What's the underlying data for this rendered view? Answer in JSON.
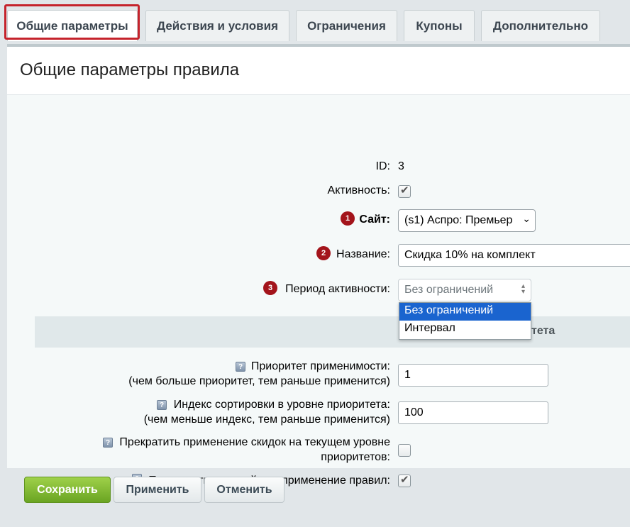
{
  "tabs": [
    "Общие параметры",
    "Действия и условия",
    "Ограничения",
    "Купоны",
    "Дополнительно"
  ],
  "panel_title": "Общие параметры правила",
  "fields": {
    "id_label": "ID:",
    "id_value": "3",
    "active_label": "Активность:",
    "active_checked": true,
    "site_label": "Сайт:",
    "site_value": "(s1) Аспро: Премьер",
    "name_label": "Название:",
    "name_value": "Скидка 10% на комплект",
    "period_label": "Период активности:",
    "period_value": "Без ограничений",
    "period_options": [
      "Без ограничений",
      "Интервал"
    ]
  },
  "badges": [
    "1",
    "2",
    "3"
  ],
  "section_title_visible": "тета",
  "priority": {
    "priority_label": "Приоритет применимости:",
    "priority_hint": "(чем больше приоритет, тем раньше применится)",
    "priority_value": "1",
    "sort_label": "Индекс сортировки в уровне приоритета:",
    "sort_hint": "(чем меньше индекс, тем раньше применится)",
    "sort_value": "100",
    "stop_level_label_1": "Прекратить применение скидок на текущем уровне",
    "stop_level_label_2": "приоритетов:",
    "stop_level_checked": false,
    "stop_further_label": "Прекратить дальнейшее применение правил:",
    "stop_further_checked": true,
    "help_glyph": "?"
  },
  "buttons": {
    "save": "Сохранить",
    "apply": "Применить",
    "cancel": "Отменить"
  },
  "colors": {
    "highlight_border": "#c5232c",
    "badge": "#a3141b",
    "save_button": "#7cb52f",
    "selected_option": "#1a64cf"
  }
}
